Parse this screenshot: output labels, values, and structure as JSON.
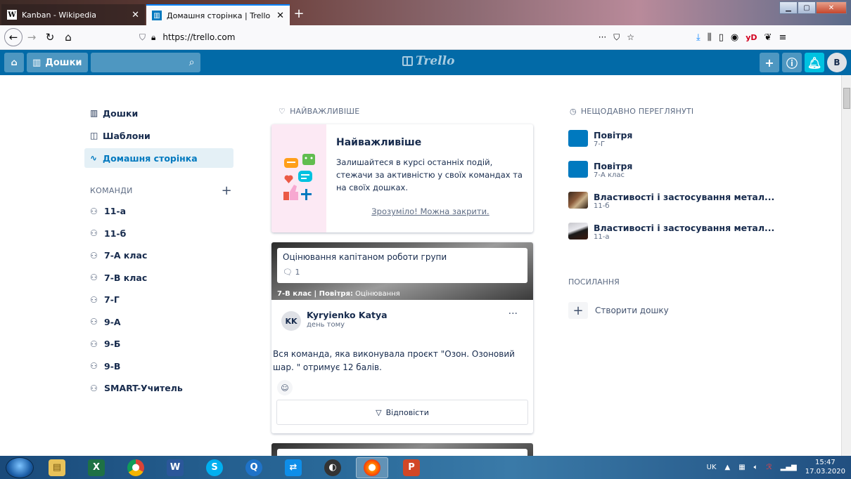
{
  "browser": {
    "tabs": [
      {
        "title": "Kanban - Wikipedia",
        "favicon": "W"
      },
      {
        "title": "Домашня сторінка | Trello",
        "favicon": "T"
      }
    ],
    "url": "https://trello.com",
    "page_actions": "···"
  },
  "header": {
    "boards_label": "Дошки",
    "search_placeholder": "",
    "logo": "Trello",
    "avatar_initial": "B"
  },
  "sidebar": {
    "items": [
      {
        "label": "Дошки"
      },
      {
        "label": "Шаблони"
      },
      {
        "label": "Домашня сторінка"
      }
    ],
    "teams_title": "КОМАНДИ",
    "teams": [
      "11-а",
      "11-б",
      "7-А клас",
      "7-В клас",
      "7-Г",
      "9-А",
      "9-Б",
      "9-В",
      "SMART-Учитель"
    ]
  },
  "highlights": {
    "title": "НАЙВАЖЛИВІШЕ",
    "promo": {
      "heading": "Найважливіше",
      "text": "Залишайтеся в курсі останніх подій, стежачи за активністю у своїх командах та на своїх дошках.",
      "dismiss": "Зрозуміло! Можна закрити."
    },
    "card": {
      "title": "Оцінювання капітаном роботи групи",
      "comments": "1",
      "breadcrumb_bold": "7-В клас | Повітря:",
      "breadcrumb_rest": " Оцінювання",
      "author_initials": "KK",
      "author": "Kyryienko Katya",
      "time": "день тому",
      "message": "Вся команда, яка виконувала проєкт \"Озон. Озоновий шар. \" отримує 12 балів.",
      "reply_label": "Відповісти"
    }
  },
  "recent": {
    "title": "НЕЩОДАВНО ПЕРЕГЛЯНУТІ",
    "boards": [
      {
        "name": "Повітря",
        "team": "7-Г"
      },
      {
        "name": "Повітря",
        "team": "7-А клас"
      },
      {
        "name": "Властивості і застосування метал...",
        "team": "11-б"
      },
      {
        "name": "Властивості і застосування метал...",
        "team": "11-а"
      }
    ]
  },
  "links": {
    "title": "ПОСИЛАННЯ",
    "create_board": "Створити дошку"
  },
  "taskbar": {
    "lang": "UK",
    "time": "15:47",
    "date": "17.03.2020"
  },
  "colors": {
    "trello_header": "#026aa7",
    "accent": "#0079bf"
  }
}
